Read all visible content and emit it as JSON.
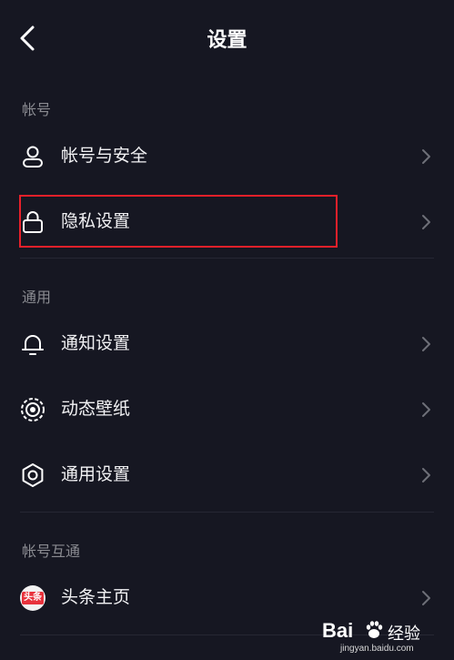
{
  "header": {
    "title": "设置"
  },
  "sections": {
    "account": {
      "title": "帐号"
    },
    "general": {
      "title": "通用"
    },
    "linked": {
      "title": "帐号互通"
    }
  },
  "rows": {
    "account_security": {
      "label": "帐号与安全",
      "icon": "user-icon"
    },
    "privacy": {
      "label": "隐私设置",
      "icon": "lock-icon"
    },
    "notifications": {
      "label": "通知设置",
      "icon": "bell-icon"
    },
    "live_wallpaper": {
      "label": "动态壁纸",
      "icon": "wallpaper-icon"
    },
    "general_settings": {
      "label": "通用设置",
      "icon": "gear-icon"
    },
    "toutiao": {
      "label": "头条主页",
      "icon": "toutiao-logo",
      "logo_text": "头条"
    }
  },
  "watermark": {
    "brand": "Bai",
    "name": "经验",
    "url": "jingyan.baidu.com"
  },
  "colors": {
    "background": "#161722",
    "highlight": "#e8202a",
    "muted_text": "#8a8b91"
  }
}
